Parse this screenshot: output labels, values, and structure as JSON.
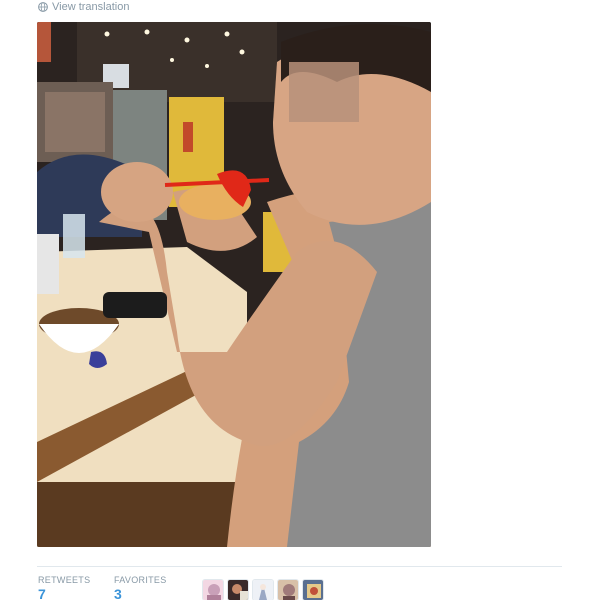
{
  "tweet": {
    "translate_label": "View translation"
  },
  "stats": {
    "retweets_label": "RETWEETS",
    "retweets_count": "7",
    "favorites_label": "FAVORITES",
    "favorites_count": "3"
  },
  "avatars": [
    {
      "name": "avatar-1",
      "color": "#c9a0b8"
    },
    {
      "name": "avatar-2",
      "color": "#3a2a2a"
    },
    {
      "name": "avatar-3",
      "color": "#d6dbe6"
    },
    {
      "name": "avatar-4",
      "color": "#a07a7a"
    },
    {
      "name": "avatar-5",
      "color": "#5a6f90"
    }
  ],
  "colors": {
    "accent": "#3b94d9",
    "muted": "#8899a6",
    "divider": "#e1e8ed"
  }
}
